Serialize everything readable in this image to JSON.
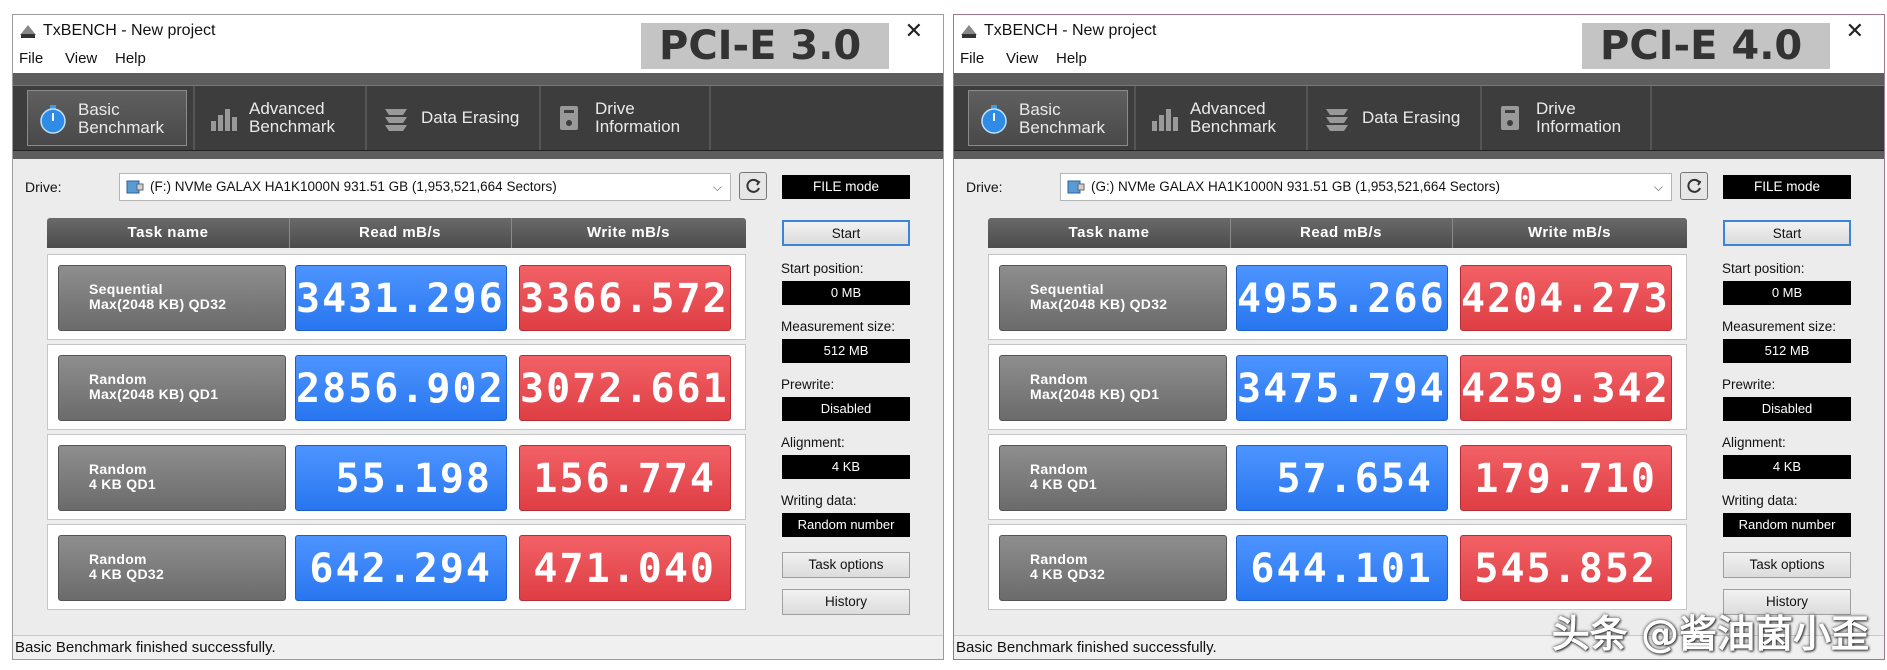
{
  "watermark": "头条 @酱油菌小歪",
  "colors": {
    "read": "#2f7ff4",
    "write": "#e5474c",
    "task": "#7a7a7a",
    "toolbar": "#3d3d3d"
  },
  "windows": [
    {
      "title": "TxBENCH - New project",
      "badge": "PCI-E 3.0",
      "menu": [
        "File",
        "View",
        "Help"
      ],
      "tabs": [
        {
          "label": "Basic\nBenchmark",
          "icon": "stopwatch-icon",
          "active": true
        },
        {
          "label": "Advanced\nBenchmark",
          "icon": "bar-chart-icon",
          "active": false
        },
        {
          "label": "Data Erasing",
          "icon": "erase-icon",
          "active": false
        },
        {
          "label": "Drive\nInformation",
          "icon": "drive-info-icon",
          "active": false
        }
      ],
      "drive_label": "Drive:",
      "drive_value": "(F:) NVMe GALAX HA1K1000N  931.51 GB (1,953,521,664 Sectors)",
      "mode": "FILE mode",
      "headers": [
        "Task name",
        "Read mB/s",
        "Write mB/s"
      ],
      "rows": [
        {
          "task": "Sequential\nMax(2048 KB) QD32",
          "read": "3431.296",
          "write": "3366.572"
        },
        {
          "task": "Random\nMax(2048 KB) QD1",
          "read": "2856.902",
          "write": "3072.661"
        },
        {
          "task": "Random\n4 KB QD1",
          "read": "55.198",
          "write": "156.774"
        },
        {
          "task": "Random\n4 KB QD32",
          "read": "642.294",
          "write": "471.040"
        }
      ],
      "start": "Start",
      "start_position_label": "Start position:",
      "start_position": "0 MB",
      "measurement_label": "Measurement size:",
      "measurement": "512 MB",
      "prewrite_label": "Prewrite:",
      "prewrite": "Disabled",
      "alignment_label": "Alignment:",
      "alignment": "4 KB",
      "writing_label": "Writing data:",
      "writing": "Random number",
      "task_options": "Task options",
      "history": "History",
      "status": "Basic Benchmark finished successfully."
    },
    {
      "title": "TxBENCH - New project",
      "badge": "PCI-E 4.0",
      "menu": [
        "File",
        "View",
        "Help"
      ],
      "tabs": [
        {
          "label": "Basic\nBenchmark",
          "icon": "stopwatch-icon",
          "active": true
        },
        {
          "label": "Advanced\nBenchmark",
          "icon": "bar-chart-icon",
          "active": false
        },
        {
          "label": "Data Erasing",
          "icon": "erase-icon",
          "active": false
        },
        {
          "label": "Drive\nInformation",
          "icon": "drive-info-icon",
          "active": false
        }
      ],
      "drive_label": "Drive:",
      "drive_value": "(G:) NVMe GALAX HA1K1000N  931.51 GB (1,953,521,664 Sectors)",
      "mode": "FILE mode",
      "headers": [
        "Task name",
        "Read mB/s",
        "Write mB/s"
      ],
      "rows": [
        {
          "task": "Sequential\nMax(2048 KB) QD32",
          "read": "4955.266",
          "write": "4204.273"
        },
        {
          "task": "Random\nMax(2048 KB) QD1",
          "read": "3475.794",
          "write": "4259.342"
        },
        {
          "task": "Random\n4 KB QD1",
          "read": "57.654",
          "write": "179.710"
        },
        {
          "task": "Random\n4 KB QD32",
          "read": "644.101",
          "write": "545.852"
        }
      ],
      "start": "Start",
      "start_position_label": "Start position:",
      "start_position": "0 MB",
      "measurement_label": "Measurement size:",
      "measurement": "512 MB",
      "prewrite_label": "Prewrite:",
      "prewrite": "Disabled",
      "alignment_label": "Alignment:",
      "alignment": "4 KB",
      "writing_label": "Writing data:",
      "writing": "Random number",
      "task_options": "Task options",
      "history": "History",
      "status": "Basic Benchmark finished successfully."
    }
  ]
}
